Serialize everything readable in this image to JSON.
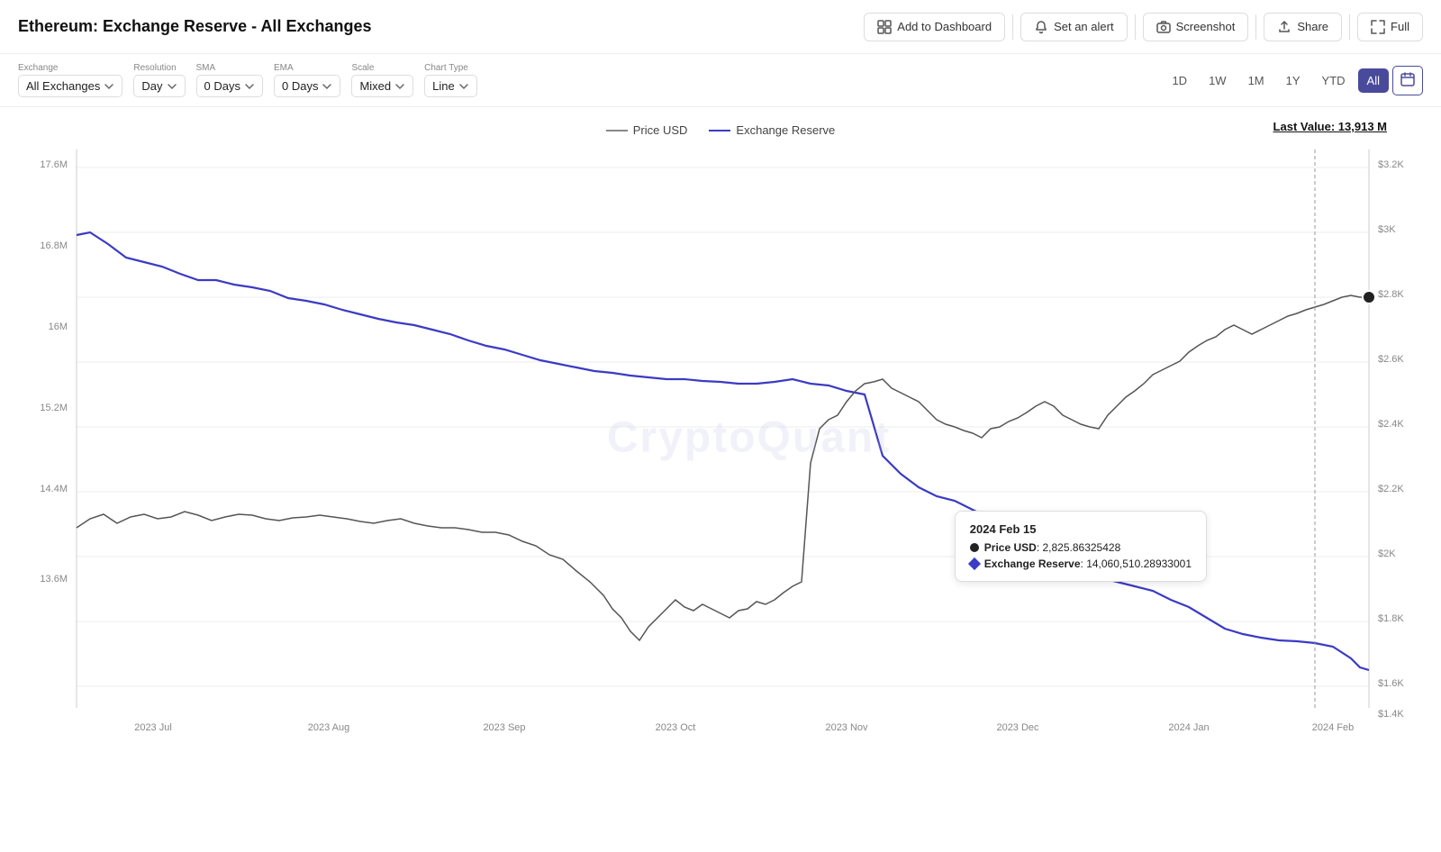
{
  "header": {
    "title": "Ethereum: Exchange Reserve - All Exchanges",
    "actions": [
      {
        "id": "add-dashboard",
        "label": "Add to Dashboard",
        "icon": "dashboard-icon"
      },
      {
        "id": "set-alert",
        "label": "Set an alert",
        "icon": "bell-icon"
      },
      {
        "id": "screenshot",
        "label": "Screenshot",
        "icon": "camera-icon"
      },
      {
        "id": "share",
        "label": "Share",
        "icon": "share-icon"
      },
      {
        "id": "full",
        "label": "Full",
        "icon": "fullscreen-icon"
      }
    ]
  },
  "toolbar": {
    "filters": [
      {
        "label": "Exchange",
        "value": "All Exchanges"
      },
      {
        "label": "Resolution",
        "value": "Day"
      },
      {
        "label": "SMA",
        "value": "0 Days"
      },
      {
        "label": "EMA",
        "value": "0 Days"
      },
      {
        "label": "Scale",
        "value": "Mixed"
      },
      {
        "label": "Chart Type",
        "value": "Line"
      }
    ],
    "timeranges": [
      "1D",
      "1W",
      "1M",
      "1Y",
      "YTD",
      "All"
    ],
    "active_timerange": "All"
  },
  "chart": {
    "legend": [
      {
        "label": "Price USD",
        "color": "gray"
      },
      {
        "label": "Exchange Reserve",
        "color": "blue"
      }
    ],
    "last_value": "Last Value: 13,913 M",
    "watermark": "CryptoQuant",
    "y_axis_left": [
      "17.6M",
      "16.8M",
      "16M",
      "15.2M",
      "14.4M",
      "13.6M"
    ],
    "y_axis_right": [
      "$3.2K",
      "$3K",
      "$2.8K",
      "$2.6K",
      "$2.4K",
      "$2.2K",
      "$2K",
      "$1.8K",
      "$1.6K",
      "$1.4K"
    ],
    "x_axis": [
      "2023 Jul",
      "2023 Aug",
      "2023 Sep",
      "2023 Oct",
      "2023 Nov",
      "2023 Dec",
      "2024 Jan",
      "2024 Feb"
    ],
    "tooltip": {
      "date": "2024 Feb 15",
      "price_usd_label": "Price USD",
      "price_usd_value": "2,825.86325428",
      "exchange_reserve_label": "Exchange Reserve",
      "exchange_reserve_value": "14,060,510.28933001"
    }
  }
}
